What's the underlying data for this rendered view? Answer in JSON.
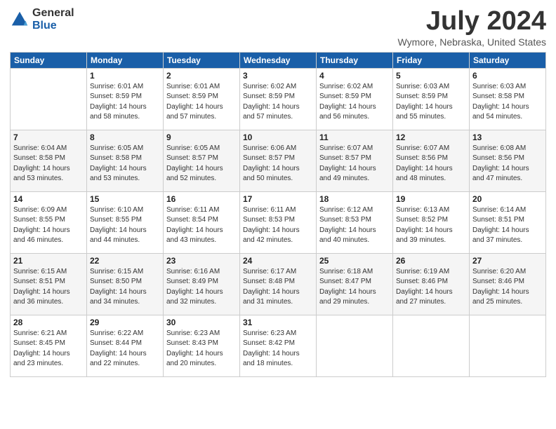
{
  "logo": {
    "general": "General",
    "blue": "Blue"
  },
  "title": {
    "month_year": "July 2024",
    "location": "Wymore, Nebraska, United States"
  },
  "weekdays": [
    "Sunday",
    "Monday",
    "Tuesday",
    "Wednesday",
    "Thursday",
    "Friday",
    "Saturday"
  ],
  "weeks": [
    [
      {
        "day": "",
        "sunrise": "",
        "sunset": "",
        "daylight": ""
      },
      {
        "day": "1",
        "sunrise": "Sunrise: 6:01 AM",
        "sunset": "Sunset: 8:59 PM",
        "daylight": "Daylight: 14 hours and 58 minutes."
      },
      {
        "day": "2",
        "sunrise": "Sunrise: 6:01 AM",
        "sunset": "Sunset: 8:59 PM",
        "daylight": "Daylight: 14 hours and 57 minutes."
      },
      {
        "day": "3",
        "sunrise": "Sunrise: 6:02 AM",
        "sunset": "Sunset: 8:59 PM",
        "daylight": "Daylight: 14 hours and 57 minutes."
      },
      {
        "day": "4",
        "sunrise": "Sunrise: 6:02 AM",
        "sunset": "Sunset: 8:59 PM",
        "daylight": "Daylight: 14 hours and 56 minutes."
      },
      {
        "day": "5",
        "sunrise": "Sunrise: 6:03 AM",
        "sunset": "Sunset: 8:59 PM",
        "daylight": "Daylight: 14 hours and 55 minutes."
      },
      {
        "day": "6",
        "sunrise": "Sunrise: 6:03 AM",
        "sunset": "Sunset: 8:58 PM",
        "daylight": "Daylight: 14 hours and 54 minutes."
      }
    ],
    [
      {
        "day": "7",
        "sunrise": "Sunrise: 6:04 AM",
        "sunset": "Sunset: 8:58 PM",
        "daylight": "Daylight: 14 hours and 53 minutes."
      },
      {
        "day": "8",
        "sunrise": "Sunrise: 6:05 AM",
        "sunset": "Sunset: 8:58 PM",
        "daylight": "Daylight: 14 hours and 53 minutes."
      },
      {
        "day": "9",
        "sunrise": "Sunrise: 6:05 AM",
        "sunset": "Sunset: 8:57 PM",
        "daylight": "Daylight: 14 hours and 52 minutes."
      },
      {
        "day": "10",
        "sunrise": "Sunrise: 6:06 AM",
        "sunset": "Sunset: 8:57 PM",
        "daylight": "Daylight: 14 hours and 50 minutes."
      },
      {
        "day": "11",
        "sunrise": "Sunrise: 6:07 AM",
        "sunset": "Sunset: 8:57 PM",
        "daylight": "Daylight: 14 hours and 49 minutes."
      },
      {
        "day": "12",
        "sunrise": "Sunrise: 6:07 AM",
        "sunset": "Sunset: 8:56 PM",
        "daylight": "Daylight: 14 hours and 48 minutes."
      },
      {
        "day": "13",
        "sunrise": "Sunrise: 6:08 AM",
        "sunset": "Sunset: 8:56 PM",
        "daylight": "Daylight: 14 hours and 47 minutes."
      }
    ],
    [
      {
        "day": "14",
        "sunrise": "Sunrise: 6:09 AM",
        "sunset": "Sunset: 8:55 PM",
        "daylight": "Daylight: 14 hours and 46 minutes."
      },
      {
        "day": "15",
        "sunrise": "Sunrise: 6:10 AM",
        "sunset": "Sunset: 8:55 PM",
        "daylight": "Daylight: 14 hours and 44 minutes."
      },
      {
        "day": "16",
        "sunrise": "Sunrise: 6:11 AM",
        "sunset": "Sunset: 8:54 PM",
        "daylight": "Daylight: 14 hours and 43 minutes."
      },
      {
        "day": "17",
        "sunrise": "Sunrise: 6:11 AM",
        "sunset": "Sunset: 8:53 PM",
        "daylight": "Daylight: 14 hours and 42 minutes."
      },
      {
        "day": "18",
        "sunrise": "Sunrise: 6:12 AM",
        "sunset": "Sunset: 8:53 PM",
        "daylight": "Daylight: 14 hours and 40 minutes."
      },
      {
        "day": "19",
        "sunrise": "Sunrise: 6:13 AM",
        "sunset": "Sunset: 8:52 PM",
        "daylight": "Daylight: 14 hours and 39 minutes."
      },
      {
        "day": "20",
        "sunrise": "Sunrise: 6:14 AM",
        "sunset": "Sunset: 8:51 PM",
        "daylight": "Daylight: 14 hours and 37 minutes."
      }
    ],
    [
      {
        "day": "21",
        "sunrise": "Sunrise: 6:15 AM",
        "sunset": "Sunset: 8:51 PM",
        "daylight": "Daylight: 14 hours and 36 minutes."
      },
      {
        "day": "22",
        "sunrise": "Sunrise: 6:15 AM",
        "sunset": "Sunset: 8:50 PM",
        "daylight": "Daylight: 14 hours and 34 minutes."
      },
      {
        "day": "23",
        "sunrise": "Sunrise: 6:16 AM",
        "sunset": "Sunset: 8:49 PM",
        "daylight": "Daylight: 14 hours and 32 minutes."
      },
      {
        "day": "24",
        "sunrise": "Sunrise: 6:17 AM",
        "sunset": "Sunset: 8:48 PM",
        "daylight": "Daylight: 14 hours and 31 minutes."
      },
      {
        "day": "25",
        "sunrise": "Sunrise: 6:18 AM",
        "sunset": "Sunset: 8:47 PM",
        "daylight": "Daylight: 14 hours and 29 minutes."
      },
      {
        "day": "26",
        "sunrise": "Sunrise: 6:19 AM",
        "sunset": "Sunset: 8:46 PM",
        "daylight": "Daylight: 14 hours and 27 minutes."
      },
      {
        "day": "27",
        "sunrise": "Sunrise: 6:20 AM",
        "sunset": "Sunset: 8:46 PM",
        "daylight": "Daylight: 14 hours and 25 minutes."
      }
    ],
    [
      {
        "day": "28",
        "sunrise": "Sunrise: 6:21 AM",
        "sunset": "Sunset: 8:45 PM",
        "daylight": "Daylight: 14 hours and 23 minutes."
      },
      {
        "day": "29",
        "sunrise": "Sunrise: 6:22 AM",
        "sunset": "Sunset: 8:44 PM",
        "daylight": "Daylight: 14 hours and 22 minutes."
      },
      {
        "day": "30",
        "sunrise": "Sunrise: 6:23 AM",
        "sunset": "Sunset: 8:43 PM",
        "daylight": "Daylight: 14 hours and 20 minutes."
      },
      {
        "day": "31",
        "sunrise": "Sunrise: 6:23 AM",
        "sunset": "Sunset: 8:42 PM",
        "daylight": "Daylight: 14 hours and 18 minutes."
      },
      {
        "day": "",
        "sunrise": "",
        "sunset": "",
        "daylight": ""
      },
      {
        "day": "",
        "sunrise": "",
        "sunset": "",
        "daylight": ""
      },
      {
        "day": "",
        "sunrise": "",
        "sunset": "",
        "daylight": ""
      }
    ]
  ]
}
